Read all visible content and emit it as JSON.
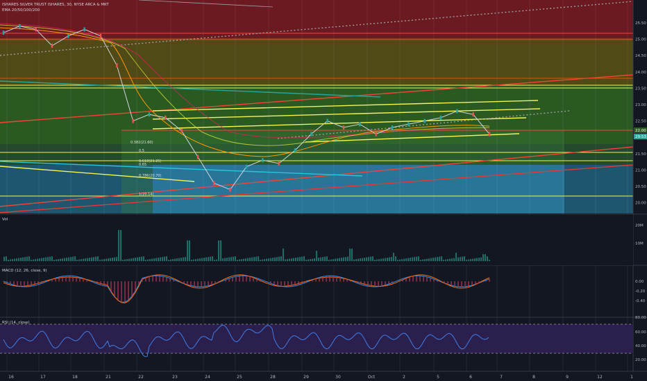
{
  "header": {
    "title": "ISHARES SILVER TRUST ISHARES, 30, NYSE ARCA & MKT",
    "indicator": "EMA 20/50/100/200"
  },
  "panes": {
    "volume": {
      "label": "Vol",
      "ticks": [
        "20M",
        "10M"
      ]
    },
    "macd": {
      "label": "MACD (12, 26, close, 9)",
      "ticks": [
        "0.00",
        "-0.20",
        "-0.40"
      ]
    },
    "rsi": {
      "label": "RSI (14, close)",
      "ticks": [
        "80.00",
        "60.00",
        "40.00",
        "20.00"
      ]
    }
  },
  "price_axis": {
    "ticks": [
      "25.50",
      "25.00",
      "24.50",
      "24.00",
      "23.50",
      "23.00",
      "22.50",
      "22.00",
      "21.50",
      "21.00",
      "20.50",
      "20.00"
    ],
    "last_price": "22.00",
    "last_price_2": "29:53"
  },
  "time_axis": {
    "labels": [
      "16",
      "17",
      "18",
      "21",
      "22",
      "23",
      "24",
      "25",
      "28",
      "29",
      "30",
      "Oct",
      "2",
      "5",
      "6",
      "7",
      "8",
      "9",
      "12",
      "1"
    ]
  },
  "fib_labels": [
    "0.382(21.60)",
    "0.5",
    "0.618(21.25)",
    "0.65",
    "0.786(20.70)",
    "1(20.14)"
  ],
  "colors": {
    "background": "#131722",
    "band_red": "#6b1a22",
    "band_olive": "#4f4a16",
    "band_green": "#2a5a22",
    "band_teal": "#1e5a6e",
    "band_blue": "#1f6ea8",
    "candle_up": "#26a69a",
    "candle_down": "#ef5350",
    "yellow_line": "#f6f353",
    "red_line": "#f44336",
    "macd_line": "#2196f3",
    "signal_line": "#ff6d00",
    "rsi_line": "#3f7fe8"
  },
  "chart_data": {
    "type": "line",
    "title": "ISHARES SILVER TRUST ISHARES, 30, NYSE ARCA & MKT",
    "series": [
      {
        "name": "Price",
        "x": [
          "16",
          "16",
          "17",
          "17",
          "18",
          "18",
          "21",
          "21",
          "21",
          "22",
          "22",
          "23",
          "23",
          "24",
          "24",
          "25",
          "25",
          "28",
          "28",
          "29",
          "29",
          "30",
          "30",
          "Oct",
          "Oct",
          "2",
          "2",
          "5",
          "5",
          "6",
          "6"
        ],
        "values": [
          25.2,
          25.4,
          25.3,
          24.8,
          25.1,
          25.3,
          25.1,
          24.2,
          22.5,
          22.7,
          22.6,
          22.2,
          21.4,
          20.6,
          20.4,
          21.1,
          21.3,
          21.2,
          21.6,
          22.1,
          22.5,
          22.3,
          22.4,
          22.1,
          22.3,
          22.4,
          22.5,
          22.6,
          22.8,
          22.7,
          22.1
        ]
      }
    ],
    "price_range": [
      19.8,
      25.7
    ],
    "volume_ylim": [
      0,
      25
    ],
    "macd_ylim": [
      -0.55,
      0.15
    ],
    "rsi_ylim": [
      15,
      85
    ],
    "grid": true
  }
}
